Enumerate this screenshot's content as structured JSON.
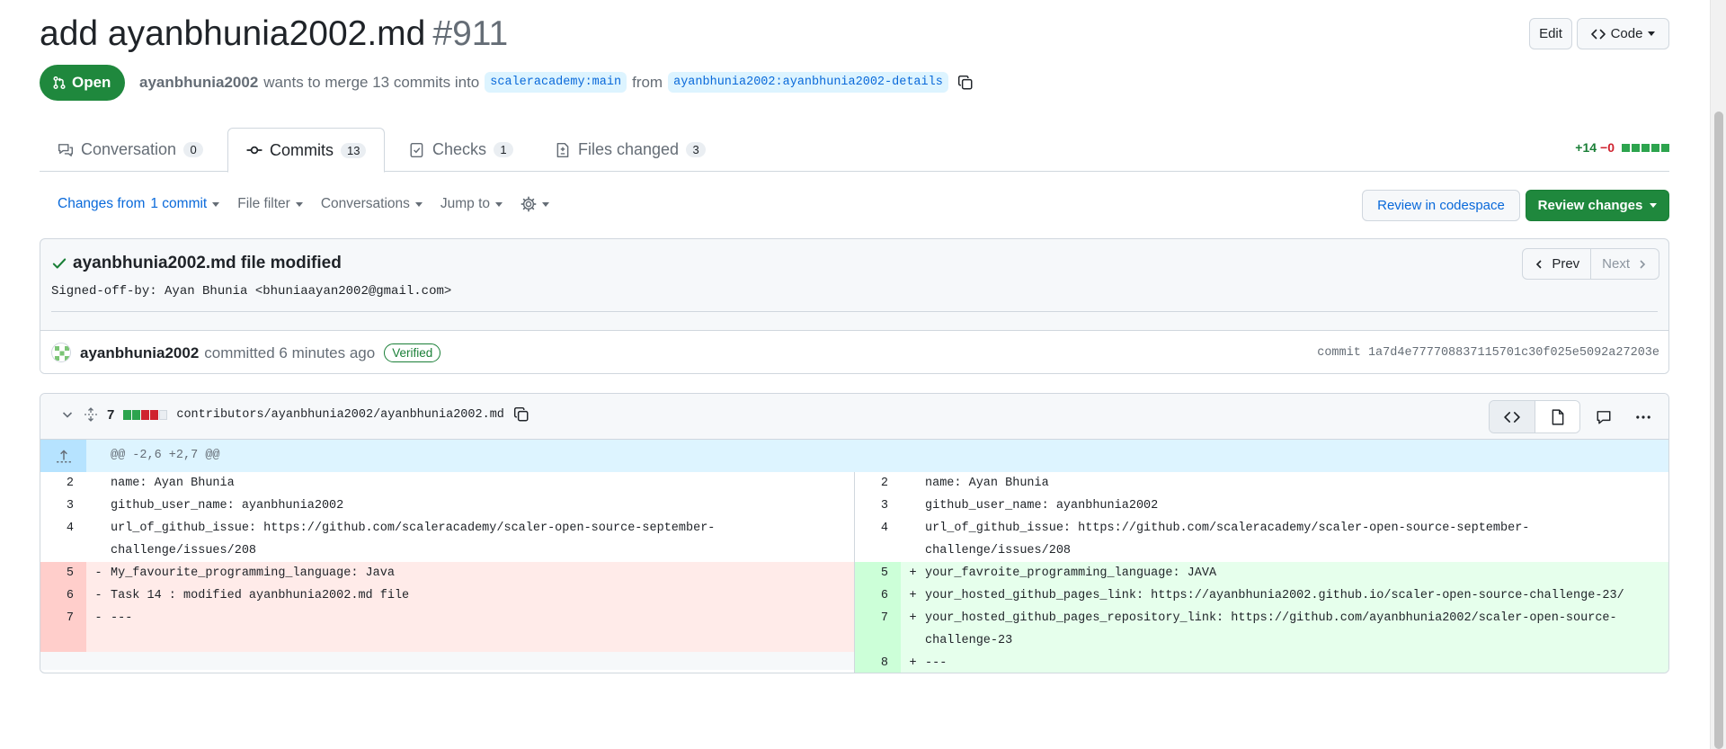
{
  "pr": {
    "title": "add ayanbhunia2002.md",
    "number": "#911",
    "state": "Open",
    "author": "ayanbhunia2002",
    "merge_text": "wants to merge 13 commits into",
    "base_branch": "scaleracademy:main",
    "from_text": "from",
    "head_branch": "ayanbhunia2002:ayanbhunia2002-details"
  },
  "header_buttons": {
    "edit": "Edit",
    "code": "Code"
  },
  "tabs": [
    {
      "label": "Conversation",
      "count": "0",
      "icon": "conversation-icon"
    },
    {
      "label": "Commits",
      "count": "13",
      "icon": "commit-icon"
    },
    {
      "label": "Checks",
      "count": "1",
      "icon": "checks-icon"
    },
    {
      "label": "Files changed",
      "count": "3",
      "icon": "file-diff-icon"
    }
  ],
  "diffstat": {
    "additions": "+14",
    "deletions": "−0",
    "blocks": 5
  },
  "toolbar": {
    "changes_from": "Changes from",
    "changes_value": "1 commit",
    "file_filter": "File filter",
    "conversations": "Conversations",
    "jump_to": "Jump to",
    "review_codespace": "Review in codespace",
    "review_changes": "Review changes"
  },
  "commit": {
    "title": "ayanbhunia2002.md file modified",
    "body": "Signed-off-by: Ayan Bhunia <bhuniaayan2002@gmail.com>",
    "prev": "Prev",
    "next": "Next",
    "author": "ayanbhunia2002",
    "committed": "committed 6 minutes ago",
    "verified": "Verified",
    "sha": "commit 1a7d4e777708837115701c30f025e5092a27203e"
  },
  "file": {
    "changes": "7",
    "path": "contributors/ayanbhunia2002/ayanbhunia2002.md",
    "hunk": "@@ -2,6 +2,7 @@",
    "left": [
      {
        "type": "ctx",
        "ln": "2",
        "marker": "",
        "code": "name: Ayan Bhunia"
      },
      {
        "type": "ctx",
        "ln": "3",
        "marker": "",
        "code": "github_user_name: ayanbhunia2002"
      },
      {
        "type": "ctx",
        "ln": "4",
        "marker": "",
        "code": "url_of_github_issue: https://github.com/scaleracademy/scaler-open-source-september-"
      },
      {
        "type": "ctx",
        "ln": "",
        "marker": "",
        "code": "challenge/issues/208"
      },
      {
        "type": "del",
        "ln": "5",
        "marker": "-",
        "code": "My_favourite_programming_language: Java"
      },
      {
        "type": "del",
        "ln": "6",
        "marker": "-",
        "code": "Task 14 : modified ayanbhunia2002.md file"
      },
      {
        "type": "del",
        "ln": "7",
        "marker": "-",
        "code": "---"
      },
      {
        "type": "filler-del",
        "ln": "",
        "marker": "",
        "code": ""
      },
      {
        "type": "empty",
        "ln": "",
        "marker": "",
        "code": ""
      }
    ],
    "right": [
      {
        "type": "ctx",
        "ln": "2",
        "marker": "",
        "code": "name: Ayan Bhunia"
      },
      {
        "type": "ctx",
        "ln": "3",
        "marker": "",
        "code": "github_user_name: ayanbhunia2002"
      },
      {
        "type": "ctx",
        "ln": "4",
        "marker": "",
        "code": "url_of_github_issue: https://github.com/scaleracademy/scaler-open-source-september-"
      },
      {
        "type": "ctx",
        "ln": "",
        "marker": "",
        "code": "challenge/issues/208"
      },
      {
        "type": "add",
        "ln": "5",
        "marker": "+",
        "code": "your_favroite_programming_language: JAVA"
      },
      {
        "type": "add",
        "ln": "6",
        "marker": "+",
        "code": "your_hosted_github_pages_link: https://ayanbhunia2002.github.io/scaler-open-source-challenge-23/"
      },
      {
        "type": "add",
        "ln": "7",
        "marker": "+",
        "code": "your_hosted_github_pages_repository_link: https://github.com/ayanbhunia2002/scaler-open-source-"
      },
      {
        "type": "add",
        "ln": "",
        "marker": "",
        "code": "challenge-23"
      },
      {
        "type": "add",
        "ln": "8",
        "marker": "+",
        "code": "---"
      }
    ]
  },
  "colors": {
    "accent": "#0969da",
    "success": "#1f883d",
    "danger": "#cf222e",
    "add_bg": "#e6ffec",
    "del_bg": "#ffebe9",
    "hunk_bg": "#ddf4ff"
  }
}
